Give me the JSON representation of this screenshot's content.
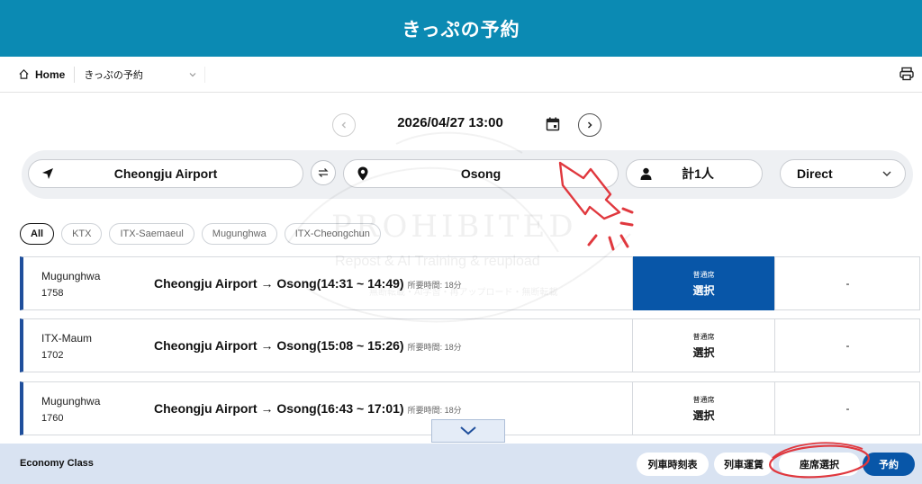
{
  "header": {
    "title": "きっぷの予約"
  },
  "breadcrumb": {
    "home": "Home",
    "current": "きっぷの予約"
  },
  "date": {
    "text": "2026/04/27 13:00"
  },
  "search": {
    "origin": "Cheongju Airport",
    "destination": "Osong",
    "passengers": "計1人",
    "trip_type": "Direct"
  },
  "filters": [
    "All",
    "KTX",
    "ITX-Saemaeul",
    "Mugunghwa",
    "ITX-Cheongchun"
  ],
  "trains": [
    {
      "name": "Mugunghwa",
      "number": "1758",
      "route": "Cheongju Airport → Osong(14:31 ~ 14:49)",
      "duration": "所要時間: 18分",
      "seat_class": "普通席",
      "select": "選択",
      "second": "-"
    },
    {
      "name": "ITX-Maum",
      "number": "1702",
      "route": "Cheongju Airport → Osong(15:08 ~ 15:26)",
      "duration": "所要時間: 18分",
      "seat_class": "普通席",
      "select": "選択",
      "second": "-"
    },
    {
      "name": "Mugunghwa",
      "number": "1760",
      "route": "Cheongju Airport → Osong(16:43 ~ 17:01)",
      "duration": "所要時間: 18分",
      "seat_class": "普通席",
      "select": "選択",
      "second": "-"
    }
  ],
  "bottom": {
    "class_label": "Economy Class",
    "timetable": "列車時刻表",
    "fare": "列車運賃",
    "seat_select": "座席選択",
    "reserve": "予約"
  },
  "watermark": {
    "line1": "PROHIBITED",
    "line2": "Repost & AI Training & reupload",
    "line3": "無断転載・AI学習・再アップロード・無断転載"
  },
  "colors": {
    "header": "#0b8ab3",
    "selected_seat": "#0856a8",
    "annotation": "#e0383e"
  }
}
